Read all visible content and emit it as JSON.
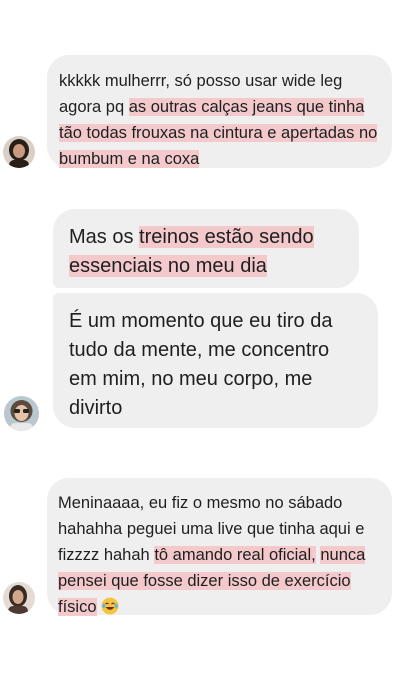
{
  "messages": [
    {
      "before": "kkkkk mulherrr, só posso usar wide leg agora pq ",
      "highlight": "as outras calças jeans que tinha tão todas frouxas na cintura e apertadas no bumbum e na coxa"
    },
    {
      "bubble_a": {
        "before": "Mas os ",
        "highlight": "treinos estão sendo essenciais no meu dia"
      },
      "bubble_b": {
        "text": "É um momento que eu tiro da tudo da mente, me concentro em mim, no meu corpo, me divirto"
      }
    },
    {
      "before": "Meninaaaa, eu fiz o mesmo no sábado hahahha peguei uma live que tinha aqui e fizzzz hahah ",
      "highlight_1": "tô amando real oficial,",
      "between": " ",
      "highlight_2": "nunca pensei que fosse dizer isso de exercício físico",
      "emoji": "laughing-tears-emoji"
    }
  ],
  "colors": {
    "bubble": "#efefef",
    "highlight": "#f3c9cc",
    "text": "#1f1f1f"
  }
}
